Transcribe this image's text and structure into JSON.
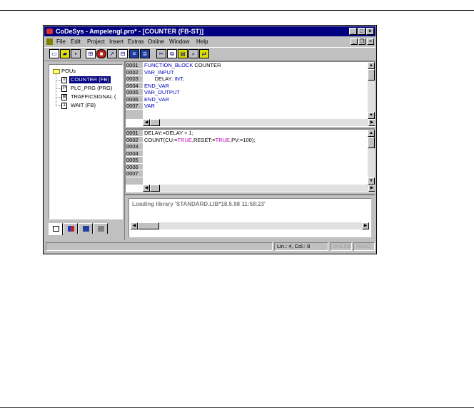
{
  "window": {
    "title": "CoDeSys - Ampelengl.pro* - [COUNTER (FB-ST)]",
    "controls": {
      "minimize": "_",
      "maximize": "□",
      "close": "×"
    },
    "mdi_controls": {
      "minimize": "_",
      "restore": "❐",
      "close": "×"
    }
  },
  "menu": [
    "File",
    "Edit",
    "Project",
    "Insert",
    "Extras",
    "Online",
    "Window",
    "Help"
  ],
  "toolbar": [
    "new-file-icon",
    "open-file-icon",
    "save-icon",
    "login-icon",
    "stop-icon",
    "run-icon",
    "logout-icon",
    "build-icon",
    "reset-icon",
    "cut-icon",
    "copy-icon",
    "paste-icon",
    "find-icon",
    "replace-icon"
  ],
  "tree": {
    "root": "POUs",
    "items": [
      {
        "label": "COUNTER (FB)",
        "selected": true
      },
      {
        "label": "PLC_PRG (PRG)",
        "selected": false
      },
      {
        "label": "TRAFFICSIGNAL (",
        "selected": false
      },
      {
        "label": "WAIT (FB)",
        "selected": false
      }
    ]
  },
  "declaration": {
    "lines": [
      "0001",
      "0002",
      "0003",
      "0004",
      "0005",
      "0006",
      "0007"
    ],
    "code": [
      {
        "kw": "FUNCTION_BLOCK",
        "rest": " COUNTER"
      },
      {
        "kw": "VAR_INPUT",
        "rest": ""
      },
      {
        "pre": "       DELAY: ",
        "kw": "INT",
        "rest": ";"
      },
      {
        "kw": "END_VAR",
        "rest": ""
      },
      {
        "kw": "VAR_OUTPUT",
        "rest": ""
      },
      {
        "kw": "END_VAR",
        "rest": ""
      },
      {
        "kw": "VAR",
        "rest": ""
      }
    ]
  },
  "body": {
    "lines": [
      "0001",
      "0002",
      "0003",
      "0004",
      "0005",
      "0006",
      "0007"
    ],
    "line1": "DELAY:=DELAY + 1;",
    "line2": {
      "a": "COUNT(CU:=",
      "t1": "TRUE",
      "b": ",RESET:=",
      "t2": "TRUE",
      "c": ",PV:=100);"
    }
  },
  "messages": {
    "text": "Loading library 'STANDARD.LIB*18.5.98 11:58:23'"
  },
  "status": {
    "position": "Lin.: 4, Col.: 8",
    "online": "ONLINE",
    "read": "READ"
  },
  "colors": {
    "titlebar": "#000080",
    "keyword": "#0000c0",
    "literal": "#c000c0",
    "face": "#c0c0c0"
  }
}
